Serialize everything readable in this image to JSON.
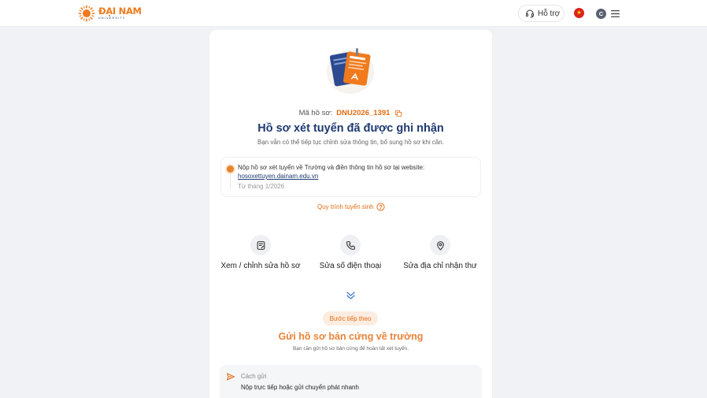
{
  "header": {
    "logo": {
      "brand": "ĐẠI NAM",
      "sub": "UNIVERSITY",
      "icon": "sun-logo-icon"
    },
    "support_label": "Hỗ trợ",
    "support_icon": "headset-icon",
    "language_flag": "vietnam-flag-icon",
    "user_initial": "C",
    "menu_icon": "hamburger-menu-icon"
  },
  "status": {
    "illustration": "documents-illustration",
    "code_label": "Mã hồ sơ:",
    "code_value": "DNU2026_1391",
    "copy_icon": "copy-icon",
    "title": "Hồ sơ xét tuyển đã được ghi nhận",
    "subtitle": "Bạn vẫn có thể tiếp tục chỉnh sửa thông tin, bổ sung hồ sơ khi cần."
  },
  "timeline": {
    "text": "Nộp hồ sơ xét tuyển về Trường và điền thông tin hồ sơ tại website:",
    "link": "hosoxettuyen.dainam.edu.vn",
    "date": "Từ tháng 1/2026"
  },
  "process_link": {
    "label": "Quy trình tuyển sinh",
    "icon": "question-circle-icon"
  },
  "actions": [
    {
      "label": "Xem / chỉnh sửa hồ sơ",
      "icon": "edit-document-icon"
    },
    {
      "label": "Sửa số điện thoại",
      "icon": "phone-icon"
    },
    {
      "label": "Sửa địa chỉ nhận thư",
      "icon": "location-pin-icon"
    }
  ],
  "next_step": {
    "expand_icon": "double-chevron-down-icon",
    "badge": "Bước tiếp theo",
    "title": "Gửi hồ sơ bản cứng về trường",
    "subtitle": "Bạn cần gửi hồ sơ bản cứng để hoàn tất xét tuyển.",
    "method_label": "Cách gửi",
    "method_value": "Nộp trực tiếp hoặc gửi chuyển phát nhanh",
    "method_icon": "send-icon"
  },
  "colors": {
    "accent": "#e26b12",
    "primary": "#1f3a72",
    "background": "#f1f2f5"
  }
}
